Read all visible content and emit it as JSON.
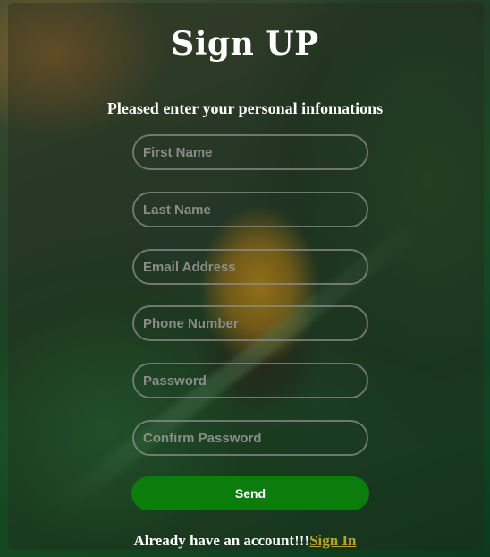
{
  "form": {
    "title": "Sign UP",
    "subtitle": "Pleased enter your personal infomations",
    "fields": {
      "first_name": {
        "placeholder": "First Name",
        "value": ""
      },
      "last_name": {
        "placeholder": "Last Name",
        "value": ""
      },
      "email": {
        "placeholder": "Email Address",
        "value": ""
      },
      "phone": {
        "placeholder": "Phone Number",
        "value": ""
      },
      "password": {
        "placeholder": "Password",
        "value": ""
      },
      "confirm_password": {
        "placeholder": "Confirm Password",
        "value": ""
      }
    },
    "send_label": "Send",
    "footer_text": "Already have an account!!!",
    "signin_label": "Sign In"
  },
  "colors": {
    "button": "#0c7d0c",
    "link": "#b8a030",
    "input_border": "#8c8c8c"
  }
}
